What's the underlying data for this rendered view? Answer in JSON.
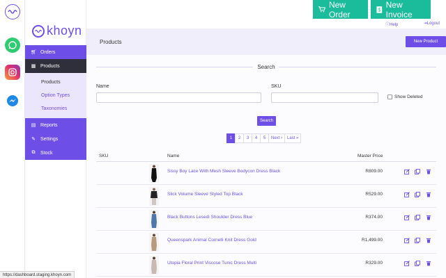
{
  "top_actions": {
    "new_order": "New Order",
    "new_invoice": "New Invoice",
    "help": "Help",
    "logout": "Logout"
  },
  "brand": {
    "name": "khoyn"
  },
  "sidebar": {
    "items": [
      {
        "label": "Orders",
        "icon": "cart-icon"
      },
      {
        "label": "Products",
        "icon": "grid-icon"
      },
      {
        "label": "Reports",
        "icon": "document-icon"
      },
      {
        "label": "Settings",
        "icon": "wrench-icon"
      },
      {
        "label": "Stock",
        "icon": "cubes-icon"
      }
    ],
    "sub_items": [
      "Products",
      "Option Types",
      "Taxonomies"
    ]
  },
  "header": {
    "title": "Products",
    "new_product": "New Product"
  },
  "search": {
    "title": "Search",
    "name_label": "Name",
    "name_value": "",
    "sku_label": "SKU",
    "sku_value": "",
    "show_deleted": "Show Deleted",
    "button": "Search"
  },
  "pagination": {
    "pages": [
      "1",
      "2",
      "3",
      "4",
      "5"
    ],
    "next": "Next ›",
    "last": "Last »",
    "current": "1"
  },
  "table": {
    "columns": {
      "sku": "SKU",
      "name": "Name",
      "price": "Master Price"
    },
    "rows": [
      {
        "name": "Sissy Boy Lace With Mesh Sleeve Bodycon Dress Black",
        "price": "R809.00"
      },
      {
        "name": "Slick Volume Sleeve Styled Top Black",
        "price": "R529.00"
      },
      {
        "name": "Black Buttons Lesedi Shoulder Dress Blue",
        "price": "R374.00"
      },
      {
        "name": "Queenspark Animal Cornelli Knit Dress Gold",
        "price": "R1,499.00"
      },
      {
        "name": "Utopia Floral Print Viscose Tunic Dress Multi",
        "price": "R329.00"
      }
    ]
  },
  "status_bar": {
    "url": "https://dashboard.staging.khoyn.com"
  },
  "colors": {
    "accent": "#6d4fe8",
    "green": "#1abc9c",
    "dark": "#2f2f3b"
  }
}
